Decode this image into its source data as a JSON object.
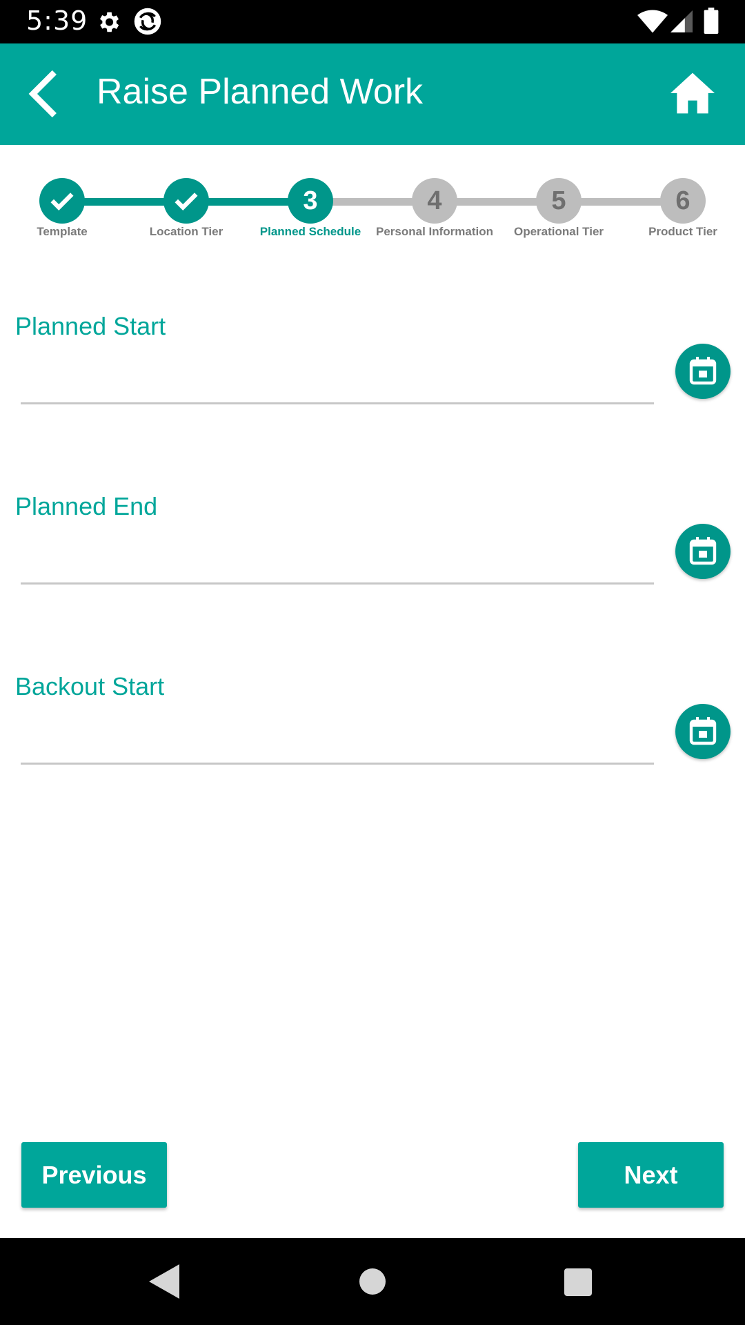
{
  "status_bar": {
    "time": "5:39",
    "icons": [
      "gear-icon",
      "app-notification-icon",
      "wifi-icon",
      "signal-icon",
      "battery-icon"
    ]
  },
  "app_bar": {
    "title": "Raise Planned Work",
    "back_icon": "chevron-left-icon",
    "home_icon": "home-icon",
    "color": "#00a69a"
  },
  "stepper": {
    "steps": [
      {
        "number": "1",
        "label": "Template",
        "state": "done"
      },
      {
        "number": "2",
        "label": "Location Tier",
        "state": "done"
      },
      {
        "number": "3",
        "label": "Planned Schedule",
        "state": "active"
      },
      {
        "number": "4",
        "label": "Personal Information",
        "state": "pending"
      },
      {
        "number": "5",
        "label": "Operational Tier",
        "state": "pending"
      },
      {
        "number": "6",
        "label": "Product Tier",
        "state": "pending"
      }
    ],
    "active_color": "#00968a",
    "pending_color": "#bdbdbd"
  },
  "form": {
    "fields": [
      {
        "label": "Planned Start",
        "value": "",
        "icon": "calendar-icon"
      },
      {
        "label": "Planned End",
        "value": "",
        "icon": "calendar-icon"
      },
      {
        "label": "Backout Start",
        "value": "",
        "icon": "calendar-icon"
      }
    ]
  },
  "actions": {
    "previous_label": "Previous",
    "next_label": "Next"
  },
  "nav_bar": {
    "icons": [
      "back-triangle-icon",
      "home-circle-icon",
      "recents-square-icon"
    ]
  }
}
